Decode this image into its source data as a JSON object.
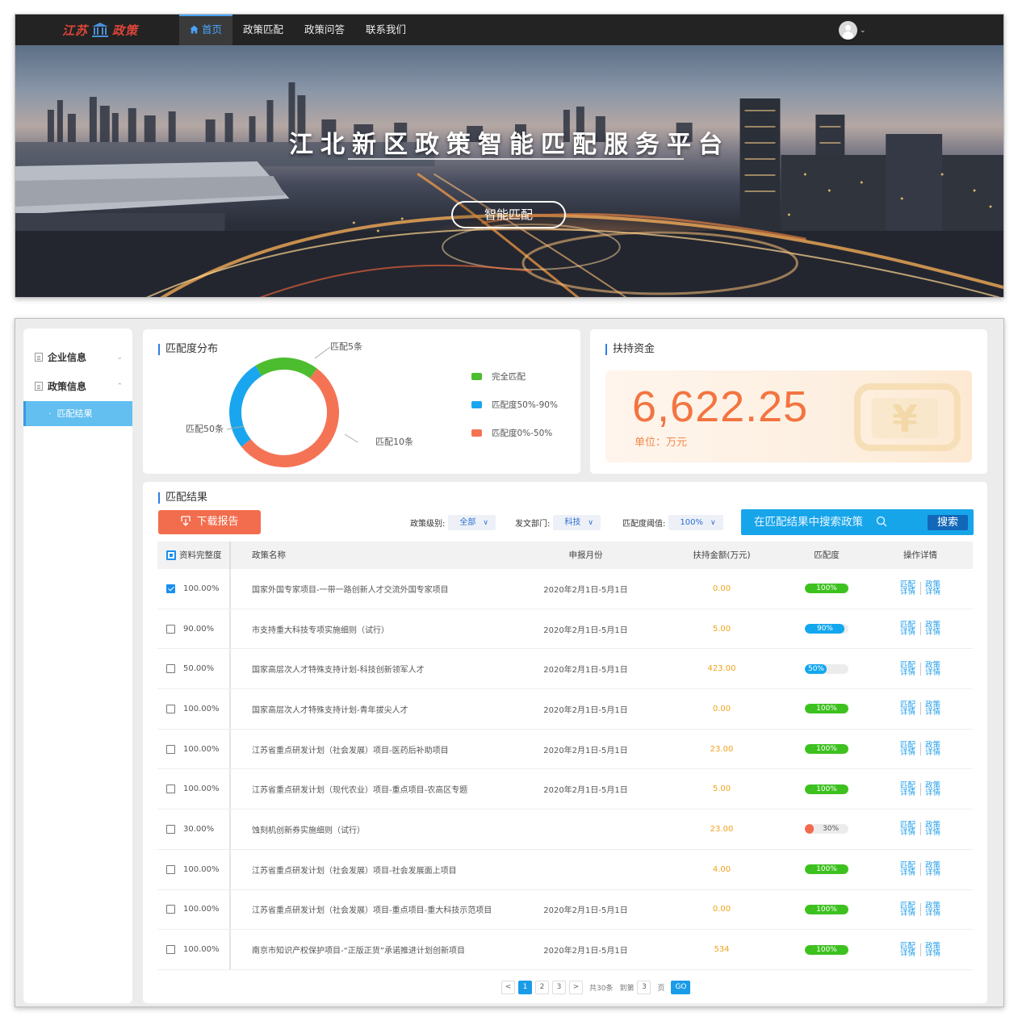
{
  "header": {
    "logo_text": "江苏政策",
    "nav": [
      {
        "label": "首页"
      },
      {
        "label": "政策匹配"
      },
      {
        "label": "政策问答"
      },
      {
        "label": "联系我们"
      }
    ]
  },
  "banner": {
    "title": "江北新区政策智能匹配服务平台",
    "button": "智能匹配"
  },
  "sidebar": {
    "groups": [
      {
        "label": "企业信息"
      },
      {
        "label": "政策信息"
      }
    ],
    "sub_item": "匹配结果"
  },
  "match_distribution": {
    "title": "匹配度分布",
    "chart_data": {
      "type": "pie",
      "title": "匹配度分布",
      "series": [
        {
          "name": "完全匹配",
          "label": "匹配5条",
          "value": 5,
          "color": "#4cbd2e"
        },
        {
          "name": "匹配度50%-90%",
          "label": "匹配50条",
          "value": 50,
          "color": "#1aa6ee"
        },
        {
          "name": "匹配度0%-50%",
          "label": "匹配10条",
          "value": 10,
          "color": "#f57355"
        }
      ],
      "legend": "right"
    }
  },
  "funding": {
    "title": "扶持资金",
    "value": "6,622.25",
    "unit": "单位：万元"
  },
  "results": {
    "title": "匹配结果",
    "download_label": "下载报告",
    "filters": [
      {
        "label": "政策级别:",
        "value": "全部"
      },
      {
        "label": "发文部门:",
        "value": "科技"
      },
      {
        "label": "匹配度阈值:",
        "value": "100%"
      }
    ],
    "search_placeholder": "在匹配结果中搜索政策",
    "search_button": "搜索",
    "columns": [
      "资料完整度",
      "政策名称",
      "申报月份",
      "扶持金额(万元)",
      "匹配度",
      "操作详情"
    ],
    "op_labels": [
      "匹配详情",
      "政策详情"
    ],
    "rows": [
      {
        "checked": true,
        "completeness": "100.00%",
        "name": "国家外国专家项目-一带一路创新人才交流外国专家项目",
        "month": "2020年2月1日-5月1日",
        "amount": "0.00",
        "match": "100%",
        "match_value": 1.0,
        "color": "#3dc11f"
      },
      {
        "checked": false,
        "completeness": "90.00%",
        "name": "市支持重大科技专项实施细则（试行）",
        "month": "2020年2月1日-5月1日",
        "amount": "5.00",
        "match": "90%",
        "match_value": 0.9,
        "color": "#12a7ee"
      },
      {
        "checked": false,
        "completeness": "50.00%",
        "name": "国家高层次人才特殊支持计划-科技创新领军人才",
        "month": "2020年2月1日-5月1日",
        "amount": "423.00",
        "match": "50%",
        "match_value": 0.5,
        "color": "#12a7ee"
      },
      {
        "checked": false,
        "completeness": "100.00%",
        "name": "国家高层次人才特殊支持计划-青年拔尖人才",
        "month": "2020年2月1日-5月1日",
        "amount": "0.00",
        "match": "100%",
        "match_value": 1.0,
        "color": "#3dc11f"
      },
      {
        "checked": false,
        "completeness": "100.00%",
        "name": "江苏省重点研发计划（社会发展）项目-医药后补助项目",
        "month": "2020年2月1日-5月1日",
        "amount": "23.00",
        "match": "100%",
        "match_value": 1.0,
        "color": "#3dc11f"
      },
      {
        "checked": false,
        "completeness": "100.00%",
        "name": "江苏省重点研发计划（现代农业）项目-重点项目-农高区专题",
        "month": "2020年2月1日-5月1日",
        "amount": "5.00",
        "match": "100%",
        "match_value": 1.0,
        "color": "#3dc11f"
      },
      {
        "checked": false,
        "completeness": "30.00%",
        "name": "蚀刻机创新券实施细则（试行）",
        "month": "",
        "amount": "23.00",
        "match": "30%",
        "match_value": 0.3,
        "color": "#f26a4e"
      },
      {
        "checked": false,
        "completeness": "100.00%",
        "name": "江苏省重点研发计划（社会发展）项目-社会发展面上项目",
        "month": "",
        "amount": "4.00",
        "match": "100%",
        "match_value": 1.0,
        "color": "#3dc11f"
      },
      {
        "checked": false,
        "completeness": "100.00%",
        "name": "江苏省重点研发计划（社会发展）项目-重点项目-重大科技示范项目",
        "month": "2020年2月1日-5月1日",
        "amount": "0.00",
        "match": "100%",
        "match_value": 1.0,
        "color": "#3dc11f"
      },
      {
        "checked": false,
        "completeness": "100.00%",
        "name": "南京市知识产权保护项目-“正版正货”承诺推进计划创新项目",
        "month": "2020年2月1日-5月1日",
        "amount": "534",
        "match": "100%",
        "match_value": 1.0,
        "color": "#3dc11f"
      }
    ]
  },
  "pagination": {
    "prev": "<",
    "pages": [
      "1",
      "2",
      "3"
    ],
    "next": ">",
    "total": "共30条",
    "goto_label": "到第",
    "goto_value": "3",
    "page_unit": "页",
    "go": "GO"
  }
}
